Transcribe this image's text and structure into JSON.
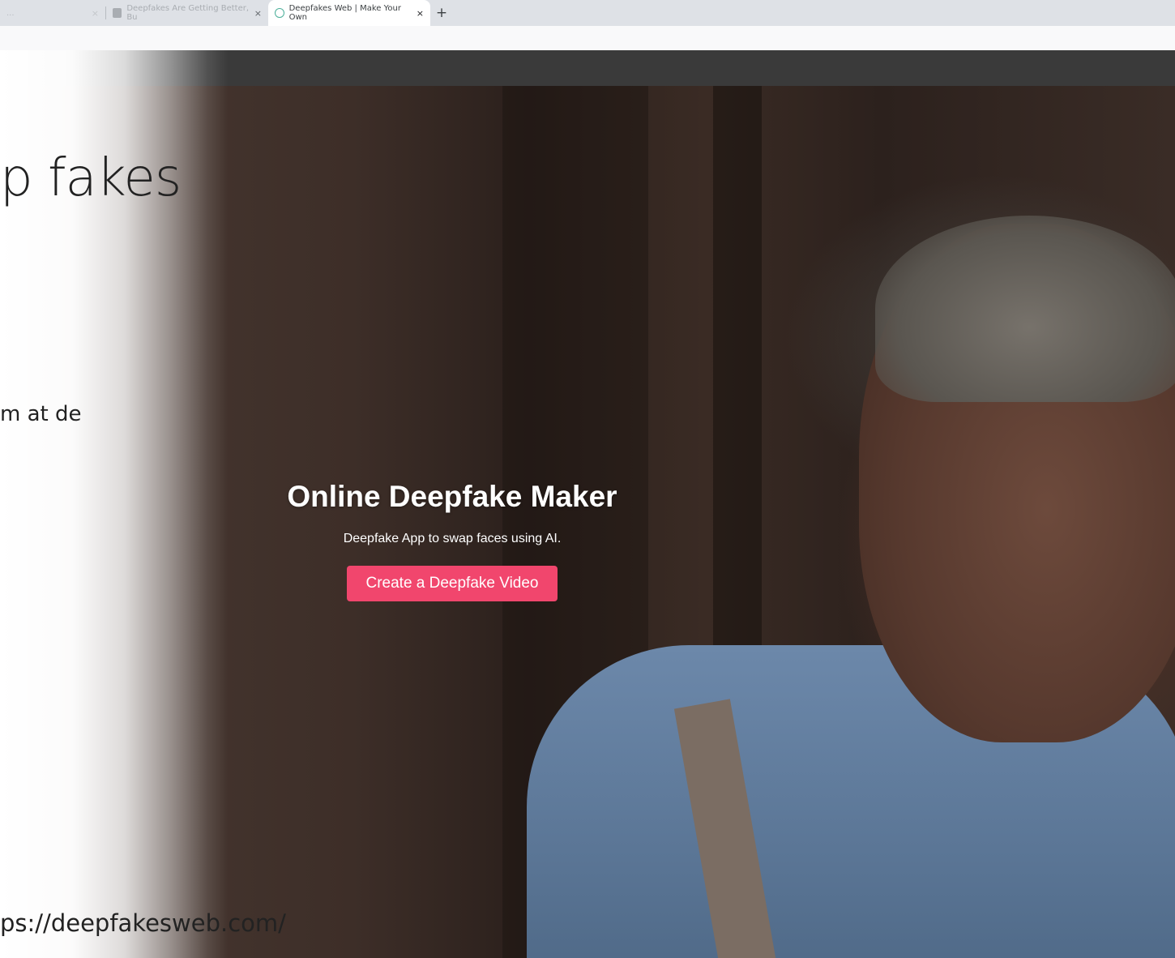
{
  "browser": {
    "tabs": [
      {
        "title": "...",
        "state": "faded"
      },
      {
        "title": "Deepfakes Are Getting Better, Bu",
        "state": "inactive"
      },
      {
        "title": "Deepfakes Web | Make Your Own",
        "state": "active"
      }
    ],
    "close_glyph": "×",
    "new_tab_glyph": "+"
  },
  "slide": {
    "title_fragment": "p fakes",
    "body_fragment": "m at de",
    "url_fragment": "ps://deepfakesweb.com/"
  },
  "hero": {
    "title": "Online Deepfake Maker",
    "subtitle": "Deepfake App to swap faces using AI.",
    "cta_label": "Create a Deepfake Video"
  },
  "colors": {
    "cta": "#f1466d",
    "header_bar": "#3a3a3a",
    "tab_strip": "#dee1e6"
  },
  "icons": {
    "favicon_active": "deepfakesweb-favicon-icon",
    "favicon_inactive": "article-favicon-icon"
  }
}
